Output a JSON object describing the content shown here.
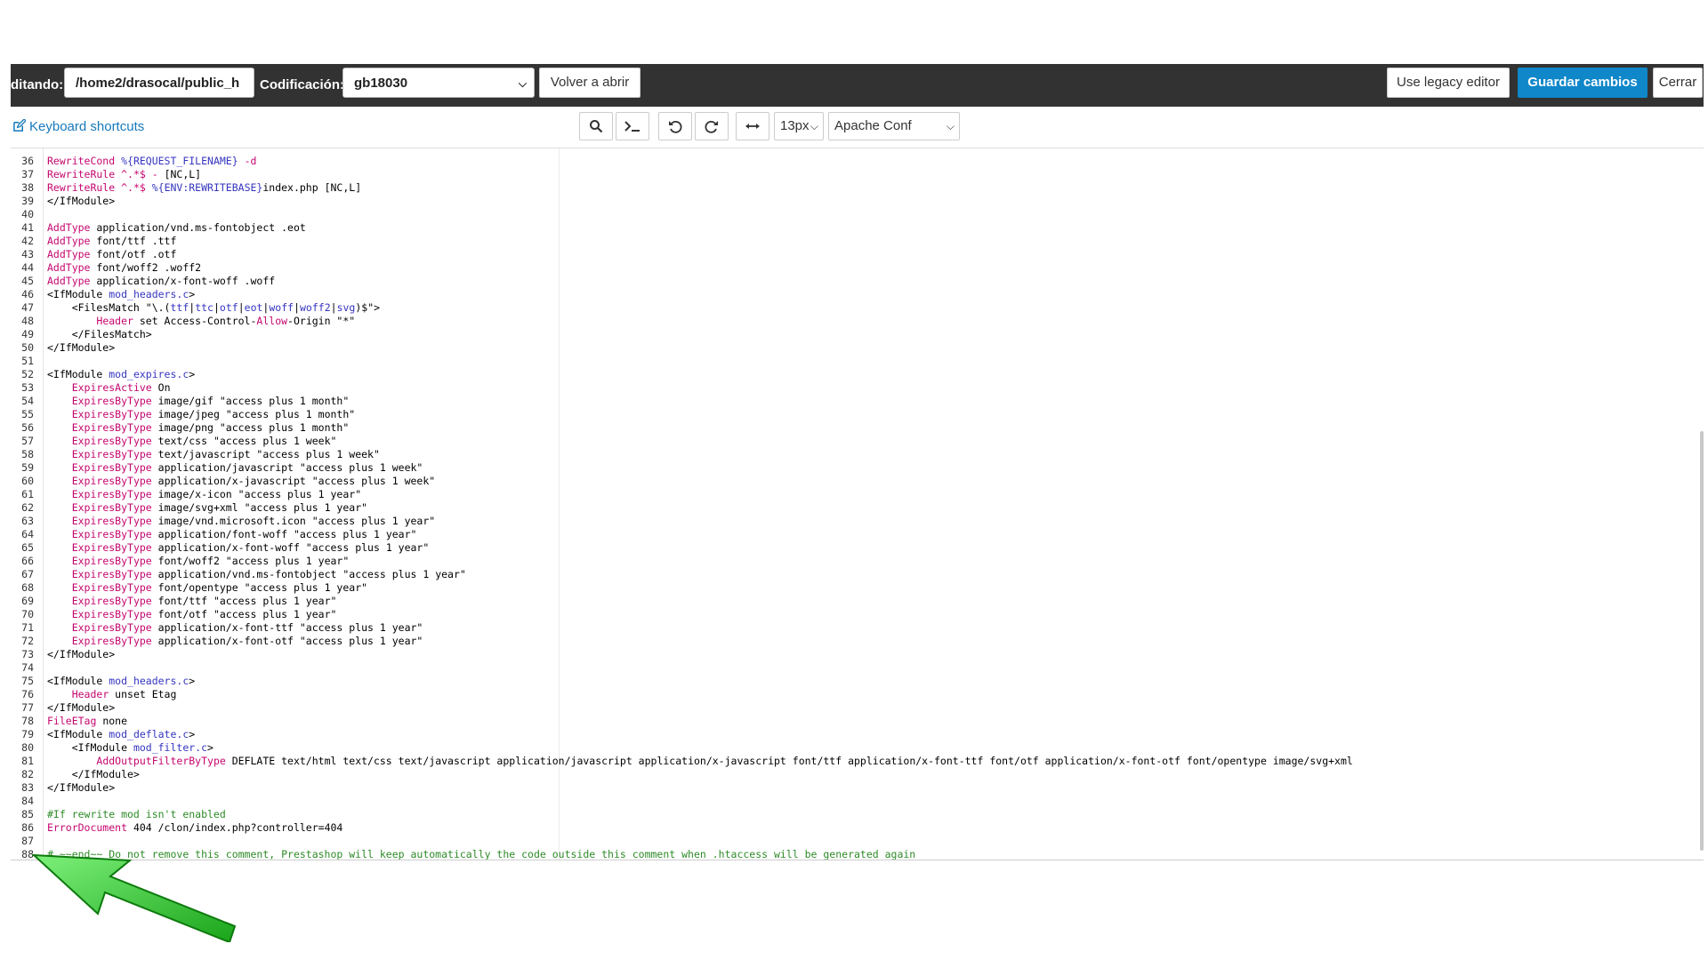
{
  "header": {
    "editing_label": "ditando:",
    "path_value": "/home2/drasocal/public_h",
    "encoding_label": "Codificación:",
    "encoding_value": "gb18030",
    "reopen_label": "Volver a abrir",
    "legacy_label": "Use legacy editor",
    "save_label": "Guardar cambios",
    "close_label": "Cerrar"
  },
  "toolbar": {
    "shortcuts_label": "Keyboard shortcuts",
    "font_size": "13px",
    "mode": "Apache Conf",
    "icons": [
      "search-icon",
      "terminal-icon",
      "undo-icon",
      "redo-icon",
      "wrap-icon"
    ]
  },
  "editor": {
    "lines": [
      {
        "n": "36",
        "segs": [
          [
            "kw",
            "RewriteCond "
          ],
          [
            "var",
            "%{REQUEST_FILENAME}"
          ],
          [
            "kw",
            " -d"
          ]
        ]
      },
      {
        "n": "37",
        "segs": [
          [
            "kw",
            "RewriteRule "
          ],
          [
            "kw",
            "^.*$ - "
          ],
          [
            "tag",
            "[NC,L]"
          ]
        ]
      },
      {
        "n": "38",
        "segs": [
          [
            "kw",
            "RewriteRule "
          ],
          [
            "kw",
            "^.*$ "
          ],
          [
            "var",
            "%{ENV:REWRITEBASE}"
          ],
          [
            "tag",
            "index.php [NC,L]"
          ]
        ]
      },
      {
        "n": "39",
        "segs": [
          [
            "tag",
            "</IfModule>"
          ]
        ]
      },
      {
        "n": "40",
        "segs": []
      },
      {
        "n": "41",
        "segs": [
          [
            "kw",
            "AddType "
          ],
          [
            "tag",
            "application/vnd.ms-fontobject .eot"
          ]
        ]
      },
      {
        "n": "42",
        "segs": [
          [
            "kw",
            "AddType "
          ],
          [
            "tag",
            "font/ttf .ttf"
          ]
        ]
      },
      {
        "n": "43",
        "segs": [
          [
            "kw",
            "AddType "
          ],
          [
            "tag",
            "font/otf .otf"
          ]
        ]
      },
      {
        "n": "44",
        "segs": [
          [
            "kw",
            "AddType "
          ],
          [
            "tag",
            "font/woff2 .woff2"
          ]
        ]
      },
      {
        "n": "45",
        "segs": [
          [
            "kw",
            "AddType "
          ],
          [
            "tag",
            "application/x-font-woff .woff"
          ]
        ]
      },
      {
        "n": "46",
        "segs": [
          [
            "tag",
            "<IfModule "
          ],
          [
            "mod",
            "mod_headers.c"
          ],
          [
            "tag",
            ">"
          ]
        ]
      },
      {
        "n": "47",
        "segs": [
          [
            "tag",
            "    <FilesMatch "
          ],
          [
            "str",
            "\"\\.("
          ],
          [
            "var",
            "ttf"
          ],
          [
            "str",
            "|"
          ],
          [
            "var",
            "ttc"
          ],
          [
            "str",
            "|"
          ],
          [
            "var",
            "otf"
          ],
          [
            "str",
            "|"
          ],
          [
            "var",
            "eot"
          ],
          [
            "str",
            "|"
          ],
          [
            "var",
            "woff"
          ],
          [
            "str",
            "|"
          ],
          [
            "var",
            "woff2"
          ],
          [
            "str",
            "|"
          ],
          [
            "var",
            "svg"
          ],
          [
            "str",
            ")$\">"
          ]
        ]
      },
      {
        "n": "48",
        "segs": [
          [
            "tag",
            "        "
          ],
          [
            "kw",
            "Header"
          ],
          [
            "tag",
            " set Access-Control-"
          ],
          [
            "kw",
            "Allow"
          ],
          [
            "tag",
            "-Origin \"*\""
          ]
        ]
      },
      {
        "n": "49",
        "segs": [
          [
            "tag",
            "    </FilesMatch>"
          ]
        ]
      },
      {
        "n": "50",
        "segs": [
          [
            "tag",
            "</IfModule>"
          ]
        ]
      },
      {
        "n": "51",
        "segs": []
      },
      {
        "n": "52",
        "segs": [
          [
            "tag",
            "<IfModule "
          ],
          [
            "mod",
            "mod_expires.c"
          ],
          [
            "tag",
            ">"
          ]
        ]
      },
      {
        "n": "53",
        "segs": [
          [
            "tag",
            "    "
          ],
          [
            "kw",
            "ExpiresActive"
          ],
          [
            "tag",
            " On"
          ]
        ]
      },
      {
        "n": "54",
        "segs": [
          [
            "tag",
            "    "
          ],
          [
            "kw",
            "ExpiresByType"
          ],
          [
            "tag",
            " image/gif \"access plus 1 month\""
          ]
        ]
      },
      {
        "n": "55",
        "segs": [
          [
            "tag",
            "    "
          ],
          [
            "kw",
            "ExpiresByType"
          ],
          [
            "tag",
            " image/jpeg \"access plus 1 month\""
          ]
        ]
      },
      {
        "n": "56",
        "segs": [
          [
            "tag",
            "    "
          ],
          [
            "kw",
            "ExpiresByType"
          ],
          [
            "tag",
            " image/png \"access plus 1 month\""
          ]
        ]
      },
      {
        "n": "57",
        "segs": [
          [
            "tag",
            "    "
          ],
          [
            "kw",
            "ExpiresByType"
          ],
          [
            "tag",
            " text/css \"access plus 1 week\""
          ]
        ]
      },
      {
        "n": "58",
        "segs": [
          [
            "tag",
            "    "
          ],
          [
            "kw",
            "ExpiresByType"
          ],
          [
            "tag",
            " text/javascript \"access plus 1 week\""
          ]
        ]
      },
      {
        "n": "59",
        "segs": [
          [
            "tag",
            "    "
          ],
          [
            "kw",
            "ExpiresByType"
          ],
          [
            "tag",
            " application/javascript \"access plus 1 week\""
          ]
        ]
      },
      {
        "n": "60",
        "segs": [
          [
            "tag",
            "    "
          ],
          [
            "kw",
            "ExpiresByType"
          ],
          [
            "tag",
            " application/x-javascript \"access plus 1 week\""
          ]
        ]
      },
      {
        "n": "61",
        "segs": [
          [
            "tag",
            "    "
          ],
          [
            "kw",
            "ExpiresByType"
          ],
          [
            "tag",
            " image/x-icon \"access plus 1 year\""
          ]
        ]
      },
      {
        "n": "62",
        "segs": [
          [
            "tag",
            "    "
          ],
          [
            "kw",
            "ExpiresByType"
          ],
          [
            "tag",
            " image/svg+xml \"access plus 1 year\""
          ]
        ]
      },
      {
        "n": "63",
        "segs": [
          [
            "tag",
            "    "
          ],
          [
            "kw",
            "ExpiresByType"
          ],
          [
            "tag",
            " image/vnd.microsoft.icon \"access plus 1 year\""
          ]
        ]
      },
      {
        "n": "64",
        "segs": [
          [
            "tag",
            "    "
          ],
          [
            "kw",
            "ExpiresByType"
          ],
          [
            "tag",
            " application/font-woff \"access plus 1 year\""
          ]
        ]
      },
      {
        "n": "65",
        "segs": [
          [
            "tag",
            "    "
          ],
          [
            "kw",
            "ExpiresByType"
          ],
          [
            "tag",
            " application/x-font-woff \"access plus 1 year\""
          ]
        ]
      },
      {
        "n": "66",
        "segs": [
          [
            "tag",
            "    "
          ],
          [
            "kw",
            "ExpiresByType"
          ],
          [
            "tag",
            " font/woff2 \"access plus 1 year\""
          ]
        ]
      },
      {
        "n": "67",
        "segs": [
          [
            "tag",
            "    "
          ],
          [
            "kw",
            "ExpiresByType"
          ],
          [
            "tag",
            " application/vnd.ms-fontobject \"access plus 1 year\""
          ]
        ]
      },
      {
        "n": "68",
        "segs": [
          [
            "tag",
            "    "
          ],
          [
            "kw",
            "ExpiresByType"
          ],
          [
            "tag",
            " font/opentype \"access plus 1 year\""
          ]
        ]
      },
      {
        "n": "69",
        "segs": [
          [
            "tag",
            "    "
          ],
          [
            "kw",
            "ExpiresByType"
          ],
          [
            "tag",
            " font/ttf \"access plus 1 year\""
          ]
        ]
      },
      {
        "n": "70",
        "segs": [
          [
            "tag",
            "    "
          ],
          [
            "kw",
            "ExpiresByType"
          ],
          [
            "tag",
            " font/otf \"access plus 1 year\""
          ]
        ]
      },
      {
        "n": "71",
        "segs": [
          [
            "tag",
            "    "
          ],
          [
            "kw",
            "ExpiresByType"
          ],
          [
            "tag",
            " application/x-font-ttf \"access plus 1 year\""
          ]
        ]
      },
      {
        "n": "72",
        "segs": [
          [
            "tag",
            "    "
          ],
          [
            "kw",
            "ExpiresByType"
          ],
          [
            "tag",
            " application/x-font-otf \"access plus 1 year\""
          ]
        ]
      },
      {
        "n": "73",
        "segs": [
          [
            "tag",
            "</IfModule>"
          ]
        ]
      },
      {
        "n": "74",
        "segs": []
      },
      {
        "n": "75",
        "segs": [
          [
            "tag",
            "<IfModule "
          ],
          [
            "mod",
            "mod_headers.c"
          ],
          [
            "tag",
            ">"
          ]
        ]
      },
      {
        "n": "76",
        "segs": [
          [
            "tag",
            "    "
          ],
          [
            "kw",
            "Header"
          ],
          [
            "tag",
            " unset Etag"
          ]
        ]
      },
      {
        "n": "77",
        "segs": [
          [
            "tag",
            "</IfModule>"
          ]
        ]
      },
      {
        "n": "78",
        "segs": [
          [
            "kw",
            "FileETag"
          ],
          [
            "tag",
            " none"
          ]
        ]
      },
      {
        "n": "79",
        "segs": [
          [
            "tag",
            "<IfModule "
          ],
          [
            "mod",
            "mod_deflate.c"
          ],
          [
            "tag",
            ">"
          ]
        ]
      },
      {
        "n": "80",
        "segs": [
          [
            "tag",
            "    <IfModule "
          ],
          [
            "mod",
            "mod_filter.c"
          ],
          [
            "tag",
            ">"
          ]
        ]
      },
      {
        "n": "81",
        "segs": [
          [
            "tag",
            "        "
          ],
          [
            "kw",
            "AddOutputFilterByType"
          ],
          [
            "tag",
            " DEFLATE text/html text/css text/javascript application/javascript application/x-javascript font/ttf application/x-font-ttf font/otf application/x-font-otf font/opentype image/svg+xml"
          ]
        ]
      },
      {
        "n": "82",
        "segs": [
          [
            "tag",
            "    </IfModule>"
          ]
        ]
      },
      {
        "n": "83",
        "segs": [
          [
            "tag",
            "</IfModule>"
          ]
        ]
      },
      {
        "n": "84",
        "segs": []
      },
      {
        "n": "85",
        "segs": [
          [
            "cmt",
            "#If rewrite mod isn't enabled"
          ]
        ]
      },
      {
        "n": "86",
        "segs": [
          [
            "kw",
            "ErrorDocument"
          ],
          [
            "tag",
            " 404 /clon/index.php?controller=404"
          ]
        ]
      },
      {
        "n": "87",
        "segs": []
      },
      {
        "n": "88",
        "segs": [
          [
            "cmt",
            "# ~~end~~ Do not remove this comment, Prestashop will keep automatically the code outside this comment when .htaccess will be generated again"
          ]
        ]
      }
    ]
  },
  "colors": {
    "topbar_bg": "#323232",
    "primary": "#0f87c9",
    "link": "#1779ba",
    "keyword": "#c5066f",
    "variable": "#3535c0",
    "comment": "#2e8b28",
    "arrow": "#22c322"
  }
}
